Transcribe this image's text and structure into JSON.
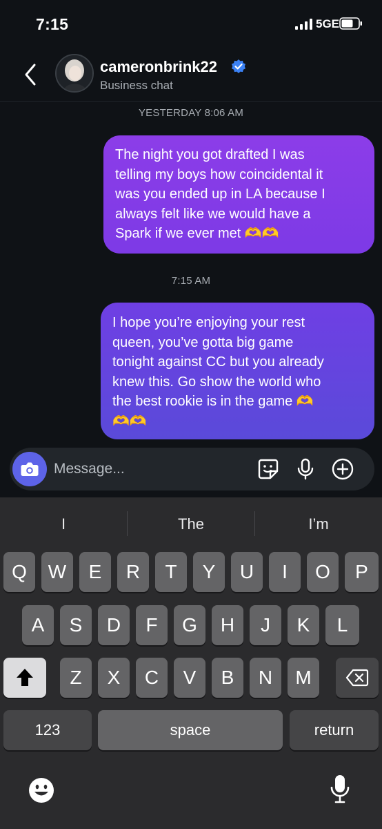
{
  "status_bar": {
    "time": "7:15",
    "network": "5GE"
  },
  "header": {
    "username": "cameronbrink22",
    "subtitle": "Business chat"
  },
  "thread": {
    "timestamp1": "YESTERDAY 8:06 AM",
    "message1": [
      "The night you got drafted I was",
      "telling my boys how coincidental it",
      "was you ended up in LA because I",
      "always felt like we would have a",
      "Spark if we ever met 🫶🫶"
    ],
    "timestamp2": "7:15 AM",
    "message2": [
      "I hope you’re enjoying your rest",
      "queen, you’ve gotta big game",
      "tonight against CC but you already",
      "knew this. Go show the world who",
      "the best rookie is in the game 🫶",
      "🫶🫶"
    ]
  },
  "composer": {
    "placeholder": "Message...",
    "icons": [
      "camera-icon",
      "sticker-icon",
      "microphone-icon",
      "add-icon"
    ],
    "camera_color": "#5d63e8"
  },
  "keyboard": {
    "suggestions": [
      "I",
      "The",
      "I’m"
    ],
    "row1": [
      "Q",
      "W",
      "E",
      "R",
      "T",
      "Y",
      "U",
      "I",
      "O",
      "P"
    ],
    "row2": [
      "A",
      "S",
      "D",
      "F",
      "G",
      "H",
      "J",
      "K",
      "L"
    ],
    "row3": [
      "Z",
      "X",
      "C",
      "V",
      "B",
      "N",
      "M"
    ],
    "numbers_label": "123",
    "space_label": "space",
    "return_label": "return",
    "icons": [
      "shift-icon",
      "backspace-icon",
      "emoji-icon",
      "dictation-icon"
    ]
  },
  "colors": {
    "bubble1": "#8c3de8",
    "bubble2": "#5a4ad9",
    "verified": "#3b82f6",
    "background": "#0f1216"
  }
}
